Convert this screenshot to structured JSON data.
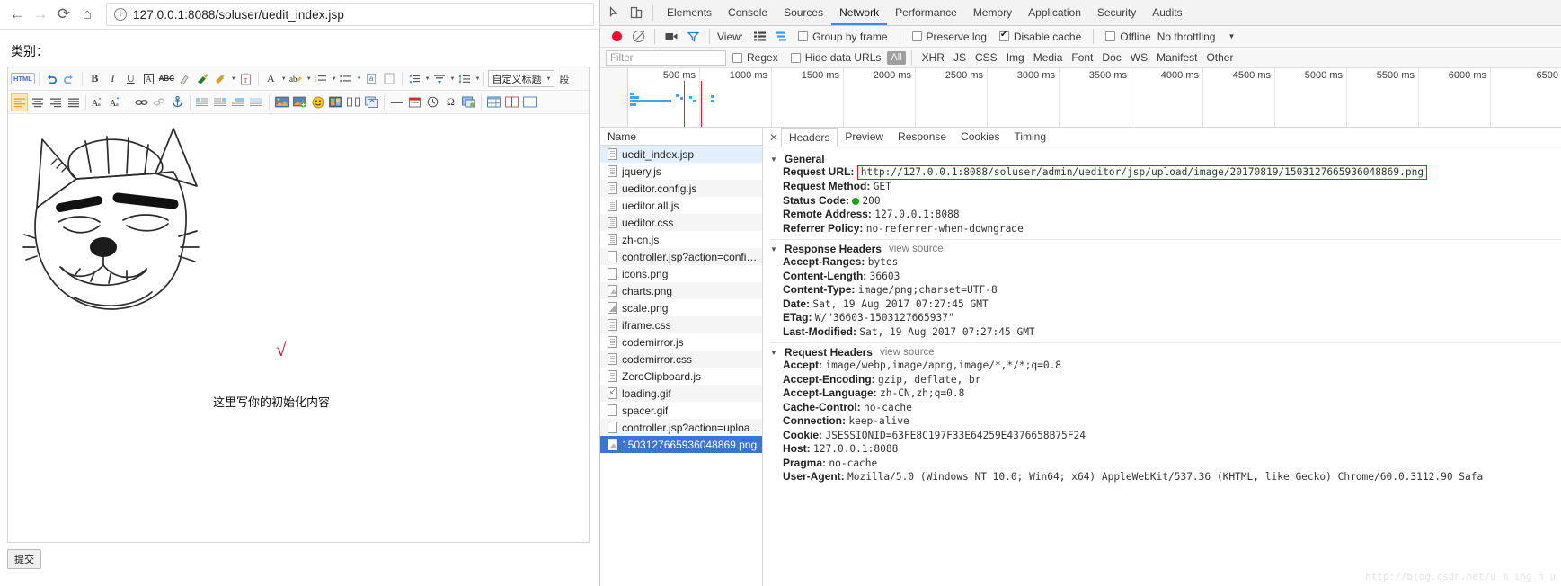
{
  "browser": {
    "nav": {
      "back_icon": "arrow-left-icon",
      "forward_icon": "arrow-right-icon",
      "reload_icon": "reload-icon",
      "home_icon": "home-icon",
      "info_icon": "site-info-icon"
    },
    "url_host": "127.0.0.1:8088",
    "url_path": "/soluser/uedit_index.jsp",
    "url_full": "127.0.0.1:8088/soluser/uedit_index.jsp"
  },
  "page": {
    "category_label": "类别：",
    "editor_content": "这里写你的初始化内容",
    "check_mark": "√",
    "submit_label": "提交",
    "toolbar_row1": [
      {
        "name": "source-code-button",
        "label": "HTML"
      },
      {
        "name": "undo-button",
        "label": ""
      },
      {
        "name": "redo-button",
        "label": ""
      },
      {
        "name": "bold-button",
        "label": "B"
      },
      {
        "name": "italic-button",
        "label": "I"
      },
      {
        "name": "underline-button",
        "label": "U"
      },
      {
        "name": "font-border-button",
        "label": "A"
      },
      {
        "name": "strikethrough-button",
        "label": "ABC"
      },
      {
        "name": "remove-format-button",
        "label": ""
      },
      {
        "name": "format-painter-button",
        "label": ""
      },
      {
        "name": "auto-typeset-button",
        "label": ""
      },
      {
        "name": "paste-plain-button",
        "label": ""
      },
      {
        "name": "font-color-button",
        "label": "A"
      },
      {
        "name": "back-color-button",
        "label": "ab"
      },
      {
        "name": "ordered-list-button",
        "label": ""
      },
      {
        "name": "unordered-list-button",
        "label": ""
      },
      {
        "name": "anchor-text-button",
        "label": "a"
      },
      {
        "name": "page-break-button",
        "label": ""
      },
      {
        "name": "row-spacing-button",
        "label": ""
      },
      {
        "name": "para-spacing-button",
        "label": ""
      },
      {
        "name": "line-height-button",
        "label": ""
      }
    ],
    "heading_select": "自定义标题",
    "toolbar_row2": [
      {
        "name": "align-left-button",
        "label": ""
      },
      {
        "name": "align-center-button",
        "label": ""
      },
      {
        "name": "align-right-button",
        "label": ""
      },
      {
        "name": "align-justify-button",
        "label": ""
      },
      {
        "name": "increase-font-size-button",
        "label": "A"
      },
      {
        "name": "decrease-font-size-button",
        "label": "A"
      },
      {
        "name": "link-button",
        "label": ""
      },
      {
        "name": "unlink-button",
        "label": ""
      },
      {
        "name": "anchor-button",
        "label": ""
      },
      {
        "name": "indent-left-button",
        "label": ""
      },
      {
        "name": "indent-right-button",
        "label": ""
      },
      {
        "name": "blockquote-button",
        "label": ""
      },
      {
        "name": "justify-button",
        "label": ""
      },
      {
        "name": "insert-image-button",
        "label": ""
      },
      {
        "name": "multi-image-upload-button",
        "label": ""
      },
      {
        "name": "emoticon-button",
        "label": ""
      },
      {
        "name": "image-gallery-button",
        "label": ""
      },
      {
        "name": "snapscreen-button",
        "label": ""
      },
      {
        "name": "webapp-button",
        "label": ""
      },
      {
        "name": "horizontal-rule-button",
        "label": "—"
      },
      {
        "name": "insert-date-button",
        "label": ""
      },
      {
        "name": "insert-time-button",
        "label": ""
      },
      {
        "name": "special-characters-button",
        "label": "Ω"
      },
      {
        "name": "background-button",
        "label": ""
      },
      {
        "name": "insert-table-button",
        "label": ""
      }
    ]
  },
  "devtools": {
    "inspect_icon": "inspect-element-icon",
    "device_icon": "device-toolbar-icon",
    "tabs": [
      {
        "label": "Elements",
        "active": false
      },
      {
        "label": "Console",
        "active": false
      },
      {
        "label": "Sources",
        "active": false
      },
      {
        "label": "Network",
        "active": true
      },
      {
        "label": "Performance",
        "active": false
      },
      {
        "label": "Memory",
        "active": false
      },
      {
        "label": "Application",
        "active": false
      },
      {
        "label": "Security",
        "active": false
      },
      {
        "label": "Audits",
        "active": false
      }
    ],
    "toolbar": {
      "record_icon": "record-button",
      "clear_icon": "clear-icon",
      "camera_icon": "screenshot-camera-icon",
      "filter_icon": "filter-funnel-icon",
      "view_label": "View:",
      "list_view_icon": "list-view-icon",
      "waterfall_view_icon": "waterfall-view-icon",
      "group_by_frame": {
        "label": "Group by frame",
        "checked": false
      },
      "preserve_log": {
        "label": "Preserve log",
        "checked": false
      },
      "disable_cache": {
        "label": "Disable cache",
        "checked": true
      },
      "offline": {
        "label": "Offline",
        "checked": false
      },
      "throttling": "No throttling",
      "throttling_caret": "chevron-down-icon"
    },
    "filterbar": {
      "filter_placeholder": "Filter",
      "regex": {
        "label": "Regex",
        "checked": false
      },
      "hide_data_urls": {
        "label": "Hide data URLs",
        "checked": false
      },
      "types": [
        "All",
        "XHR",
        "JS",
        "CSS",
        "Img",
        "Media",
        "Font",
        "Doc",
        "WS",
        "Manifest",
        "Other"
      ],
      "active_type": "All"
    },
    "timeline": {
      "ticks": [
        "500 ms",
        "1000 ms",
        "1500 ms",
        "2000 ms",
        "2500 ms",
        "3000 ms",
        "3500 ms",
        "4000 ms",
        "4500 ms",
        "5000 ms",
        "5500 ms",
        "6000 ms",
        "6500"
      ]
    },
    "requests": {
      "column_header": "Name",
      "rows": [
        {
          "name": "uedit_index.jsp",
          "icon": "document-icon",
          "state": "highlight"
        },
        {
          "name": "jquery.js",
          "icon": "document-icon",
          "state": "plain"
        },
        {
          "name": "ueditor.config.js",
          "icon": "document-icon",
          "state": "alt"
        },
        {
          "name": "ueditor.all.js",
          "icon": "document-icon",
          "state": "plain"
        },
        {
          "name": "ueditor.css",
          "icon": "document-icon",
          "state": "alt"
        },
        {
          "name": "zh-cn.js",
          "icon": "document-icon",
          "state": "plain"
        },
        {
          "name": "controller.jsp?action=config&…",
          "icon": "plain-icon",
          "state": "alt"
        },
        {
          "name": "icons.png",
          "icon": "image-icon",
          "state": "plain"
        },
        {
          "name": "charts.png",
          "icon": "image-icon",
          "state": "alt"
        },
        {
          "name": "scale.png",
          "icon": "scale-icon",
          "state": "plain"
        },
        {
          "name": "iframe.css",
          "icon": "document-icon",
          "state": "alt"
        },
        {
          "name": "codemirror.js",
          "icon": "document-icon",
          "state": "plain"
        },
        {
          "name": "codemirror.css",
          "icon": "document-icon",
          "state": "alt"
        },
        {
          "name": "ZeroClipboard.js",
          "icon": "document-icon",
          "state": "plain"
        },
        {
          "name": "loading.gif",
          "icon": "gif-icon",
          "state": "alt"
        },
        {
          "name": "spacer.gif",
          "icon": "plain-icon",
          "state": "plain"
        },
        {
          "name": "controller.jsp?action=uploadi…",
          "icon": "plain-icon",
          "state": "alt"
        },
        {
          "name": "1503127665936048869.png",
          "icon": "image-icon",
          "state": "selected"
        }
      ]
    },
    "detail": {
      "close_icon": "close-icon",
      "tabs": [
        {
          "label": "Headers",
          "active": true
        },
        {
          "label": "Preview",
          "active": false
        },
        {
          "label": "Response",
          "active": false
        },
        {
          "label": "Cookies",
          "active": false
        },
        {
          "label": "Timing",
          "active": false
        }
      ],
      "general": {
        "title": "General",
        "request_url_key": "Request URL:",
        "request_url_value": "http://127.0.0.1:8088/soluser/admin/ueditor/jsp/upload/image/20170819/1503127665936048869.png",
        "rows": [
          {
            "key": "Request Method:",
            "value": "GET"
          },
          {
            "key": "Status Code:",
            "value": "200",
            "status": "green"
          },
          {
            "key": "Remote Address:",
            "value": "127.0.0.1:8088"
          },
          {
            "key": "Referrer Policy:",
            "value": "no-referrer-when-downgrade"
          }
        ]
      },
      "response_headers": {
        "title": "Response Headers",
        "view_source": "view source",
        "rows": [
          {
            "key": "Accept-Ranges:",
            "value": "bytes"
          },
          {
            "key": "Content-Length:",
            "value": "36603"
          },
          {
            "key": "Content-Type:",
            "value": "image/png;charset=UTF-8"
          },
          {
            "key": "Date:",
            "value": "Sat, 19 Aug 2017 07:27:45 GMT"
          },
          {
            "key": "ETag:",
            "value": "W/\"36603-1503127665937\""
          },
          {
            "key": "Last-Modified:",
            "value": "Sat, 19 Aug 2017 07:27:45 GMT"
          }
        ]
      },
      "request_headers": {
        "title": "Request Headers",
        "view_source": "view source",
        "rows": [
          {
            "key": "Accept:",
            "value": "image/webp,image/apng,image/*,*/*;q=0.8"
          },
          {
            "key": "Accept-Encoding:",
            "value": "gzip, deflate, br"
          },
          {
            "key": "Accept-Language:",
            "value": "zh-CN,zh;q=0.8"
          },
          {
            "key": "Cache-Control:",
            "value": "no-cache"
          },
          {
            "key": "Connection:",
            "value": "keep-alive"
          },
          {
            "key": "Cookie:",
            "value": "JSESSIONID=63FE8C197F33E64259E4376658B75F24"
          },
          {
            "key": "Host:",
            "value": "127.0.0.1:8088"
          },
          {
            "key": "Pragma:",
            "value": "no-cache"
          },
          {
            "key": "User-Agent:",
            "value": "Mozilla/5.0 (Windows NT 10.0; Win64; x64) AppleWebKit/537.36 (KHTML, like Gecko) Chrome/60.0.3112.90 Safa"
          }
        ]
      }
    },
    "watermark": "http://blog.csdn.net/u_m_ing_h_u"
  }
}
